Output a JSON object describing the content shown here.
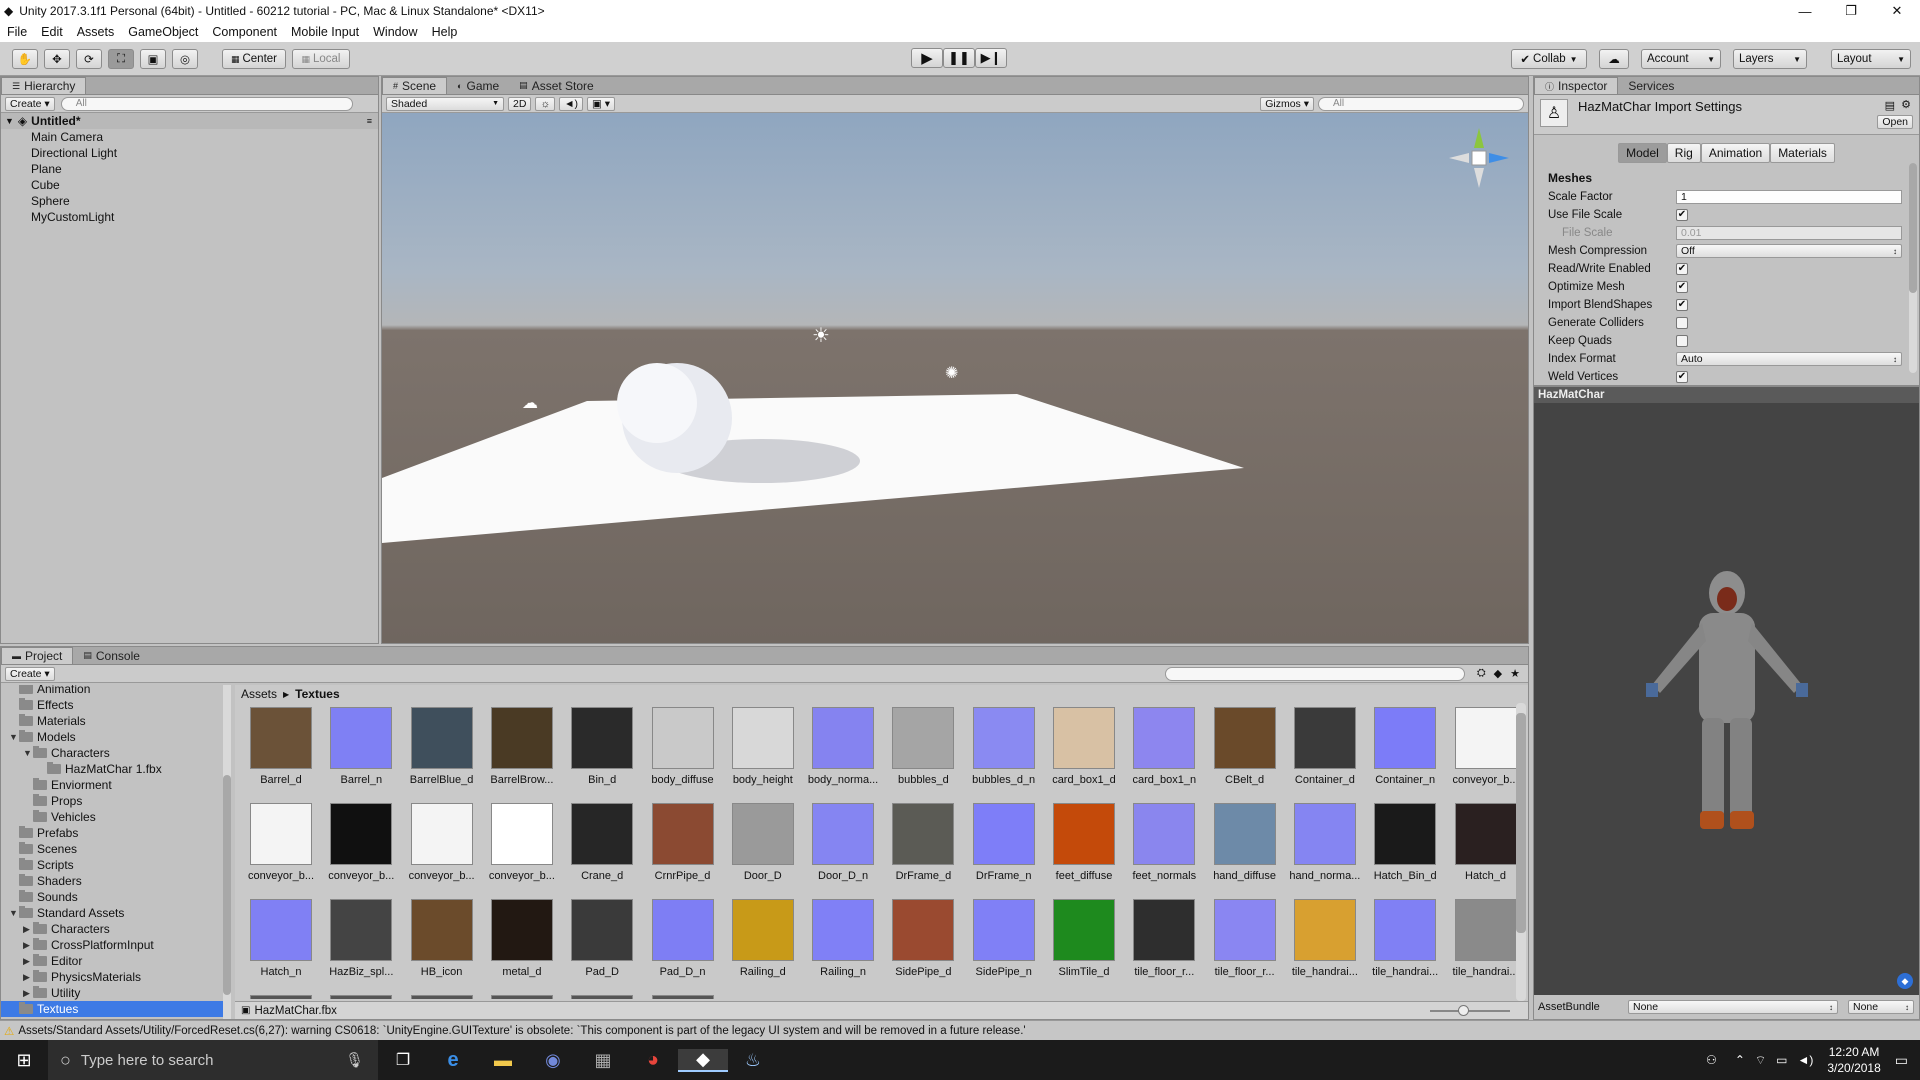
{
  "window": {
    "title": "Unity 2017.3.1f1 Personal (64bit) - Untitled - 60212 tutorial - PC, Mac & Linux Standalone* <DX11>"
  },
  "menu": [
    "File",
    "Edit",
    "Assets",
    "GameObject",
    "Component",
    "Mobile Input",
    "Window",
    "Help"
  ],
  "toolbar": {
    "center_label": "Center",
    "local_label": "Local",
    "collab_label": "Collab",
    "account_label": "Account",
    "layers_label": "Layers",
    "layout_label": "Layout"
  },
  "hierarchy": {
    "tab": "Hierarchy",
    "create": "Create",
    "search_placeholder": "All",
    "scene_name": "Untitled*",
    "items": [
      "Main Camera",
      "Directional Light",
      "Plane",
      "Cube",
      "Sphere",
      "MyCustomLight"
    ]
  },
  "scene": {
    "tabs": [
      "Scene",
      "Game",
      "Asset Store"
    ],
    "shading": "Shaded",
    "mode_2d": "2D",
    "gizmos": "Gizmos",
    "search_placeholder": "All"
  },
  "inspector": {
    "tabs": [
      "Inspector",
      "Services"
    ],
    "title": "HazMatChar Import Settings",
    "open_label": "Open",
    "section_tabs": [
      "Model",
      "Rig",
      "Animation",
      "Materials"
    ],
    "section_header": "Meshes",
    "rows": {
      "scale_factor": {
        "label": "Scale Factor",
        "value": "1"
      },
      "use_file_scale": {
        "label": "Use File Scale",
        "checked": true
      },
      "file_scale": {
        "label": "File Scale",
        "value": "0.01"
      },
      "mesh_compression": {
        "label": "Mesh Compression",
        "value": "Off"
      },
      "read_write": {
        "label": "Read/Write Enabled",
        "checked": true
      },
      "optimize_mesh": {
        "label": "Optimize Mesh",
        "checked": true
      },
      "import_blendshapes": {
        "label": "Import BlendShapes",
        "checked": true
      },
      "generate_colliders": {
        "label": "Generate Colliders",
        "checked": false
      },
      "keep_quads": {
        "label": "Keep Quads",
        "checked": false
      },
      "index_format": {
        "label": "Index Format",
        "value": "Auto"
      },
      "weld_vertices": {
        "label": "Weld Vertices",
        "checked": true
      }
    },
    "preview_title": "HazMatChar",
    "assetbundle_label": "AssetBundle",
    "assetbundle_value": "None",
    "assetbundle_variant": "None"
  },
  "project": {
    "tabs": [
      "Project",
      "Console"
    ],
    "create": "Create",
    "breadcrumb": [
      "Assets",
      "Textues"
    ],
    "selected_file": "HazMatChar.fbx",
    "tree": [
      {
        "label": "Animation",
        "depth": 1
      },
      {
        "label": "Effects",
        "depth": 1
      },
      {
        "label": "Materials",
        "depth": 1
      },
      {
        "label": "Models",
        "depth": 1
      },
      {
        "label": "Characters",
        "depth": 2
      },
      {
        "label": "HazMatChar 1.fbx",
        "depth": 3
      },
      {
        "label": "Enviorment",
        "depth": 2
      },
      {
        "label": "Props",
        "depth": 2
      },
      {
        "label": "Vehicles",
        "depth": 2
      },
      {
        "label": "Prefabs",
        "depth": 1
      },
      {
        "label": "Scenes",
        "depth": 1
      },
      {
        "label": "Scripts",
        "depth": 1
      },
      {
        "label": "Shaders",
        "depth": 1
      },
      {
        "label": "Sounds",
        "depth": 1
      },
      {
        "label": "Standard Assets",
        "depth": 1
      },
      {
        "label": "Characters",
        "depth": 2
      },
      {
        "label": "CrossPlatformInput",
        "depth": 2
      },
      {
        "label": "Editor",
        "depth": 2
      },
      {
        "label": "PhysicsMaterials",
        "depth": 2
      },
      {
        "label": "Utility",
        "depth": 2
      },
      {
        "label": "Textues",
        "depth": 1
      }
    ],
    "assets": [
      {
        "name": "Barrel_d",
        "color": "#6b5238"
      },
      {
        "name": "Barrel_n",
        "color": "#7f80f4"
      },
      {
        "name": "BarrelBlue_d",
        "color": "#3f4f5c"
      },
      {
        "name": "BarrelBrow...",
        "color": "#4a3a24"
      },
      {
        "name": "Bin_d",
        "color": "#2a2a2a"
      },
      {
        "name": "body_diffuse",
        "color": "#c9c9c9"
      },
      {
        "name": "body_height",
        "color": "#d8d8d8"
      },
      {
        "name": "body_norma...",
        "color": "#8583f0"
      },
      {
        "name": "bubbles_d",
        "color": "#a5a5a5"
      },
      {
        "name": "bubbles_d_n",
        "color": "#8a8af2"
      },
      {
        "name": "card_box1_d",
        "color": "#d8c1a4"
      },
      {
        "name": "card_box1_n",
        "color": "#8d86ef"
      },
      {
        "name": "CBelt_d",
        "color": "#6a4a2a"
      },
      {
        "name": "Container_d",
        "color": "#3a3a3a"
      },
      {
        "name": "Container_n",
        "color": "#7c7cf8"
      },
      {
        "name": "conveyor_b...",
        "color": "#f4f4f4"
      },
      {
        "name": "conveyor_b...",
        "color": "#f4f4f4"
      },
      {
        "name": "conveyor_b...",
        "color": "#101010"
      },
      {
        "name": "conveyor_b...",
        "color": "#f4f4f4"
      },
      {
        "name": "conveyor_b...",
        "color": "#ffffff"
      },
      {
        "name": "Crane_d",
        "color": "#262626"
      },
      {
        "name": "CrnrPipe_d",
        "color": "#8b4a32"
      },
      {
        "name": "Door_D",
        "color": "#9a9a9a"
      },
      {
        "name": "Door_D_n",
        "color": "#8585f2"
      },
      {
        "name": "DrFrame_d",
        "color": "#5b5b55"
      },
      {
        "name": "DrFrame_n",
        "color": "#7e7ef8"
      },
      {
        "name": "feet_diffuse",
        "color": "#c44a0a"
      },
      {
        "name": "feet_normals",
        "color": "#8a86ee"
      },
      {
        "name": "hand_diffuse",
        "color": "#6d8aa8"
      },
      {
        "name": "hand_norma...",
        "color": "#8585f2"
      },
      {
        "name": "Hatch_Bin_d",
        "color": "#1a1a1a"
      },
      {
        "name": "Hatch_d",
        "color": "#2a2020"
      },
      {
        "name": "Hatch_n",
        "color": "#8080f4"
      },
      {
        "name": "HazBiz_spl...",
        "color": "#444444"
      },
      {
        "name": "HB_icon",
        "color": "#6b4b2b"
      },
      {
        "name": "metal_d",
        "color": "#221812"
      },
      {
        "name": "Pad_D",
        "color": "#3a3a3a"
      },
      {
        "name": "Pad_D_n",
        "color": "#7e7ef4"
      },
      {
        "name": "Railing_d",
        "color": "#c89a18"
      },
      {
        "name": "Railing_n",
        "color": "#8080f6"
      },
      {
        "name": "SidePipe_d",
        "color": "#9a4a30"
      },
      {
        "name": "SidePipe_n",
        "color": "#8080f6"
      },
      {
        "name": "SlimTile_d",
        "color": "#1e8a1e"
      },
      {
        "name": "tile_floor_r...",
        "color": "#2e2e2e"
      },
      {
        "name": "tile_floor_r...",
        "color": "#8a86f2"
      },
      {
        "name": "tile_handrai...",
        "color": "#d8a030"
      },
      {
        "name": "tile_handrai...",
        "color": "#8080f4"
      },
      {
        "name": "tile_handrai...",
        "color": "#8a8a8a"
      }
    ]
  },
  "status": {
    "message": "Assets/Standard Assets/Utility/ForcedReset.cs(6,27): warning CS0618: `UnityEngine.GUITexture' is obsolete: `This component is part of the legacy UI system and will be removed in a future release.'"
  },
  "taskbar": {
    "search_placeholder": "Type here to search",
    "time": "12:20 AM",
    "date": "3/20/2018"
  }
}
